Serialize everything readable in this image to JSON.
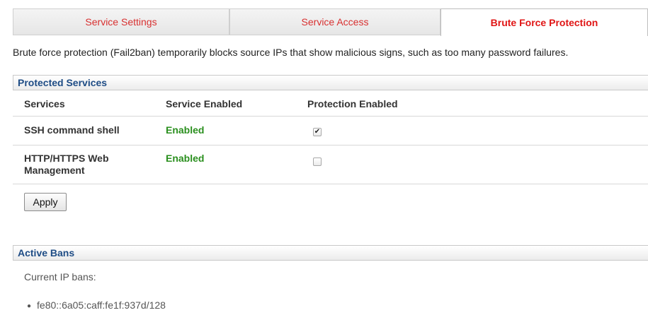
{
  "tabs": [
    {
      "label": "Service Settings",
      "active": false
    },
    {
      "label": "Service Access",
      "active": false
    },
    {
      "label": "Brute Force Protection",
      "active": true
    }
  ],
  "intro": "Brute force protection (Fail2ban) temporarily blocks source IPs that show malicious signs, such as too many password failures.",
  "protected_services": {
    "title": "Protected Services",
    "columns": [
      "Services",
      "Service Enabled",
      "Protection Enabled"
    ],
    "rows": [
      {
        "service": "SSH command shell",
        "enabled": "Enabled",
        "protection_checked": true
      },
      {
        "service": "HTTP/HTTPS Web Management",
        "enabled": "Enabled",
        "protection_checked": false
      }
    ],
    "apply_label": "Apply"
  },
  "active_bans": {
    "title": "Active Bans",
    "label": "Current IP bans:",
    "items": [
      "fe80::6a05:caff:fe1f:937d/128"
    ]
  },
  "colors": {
    "tab_text": "#d83030",
    "section_title": "#1e4c85",
    "enabled_text": "#2a8f1e"
  }
}
